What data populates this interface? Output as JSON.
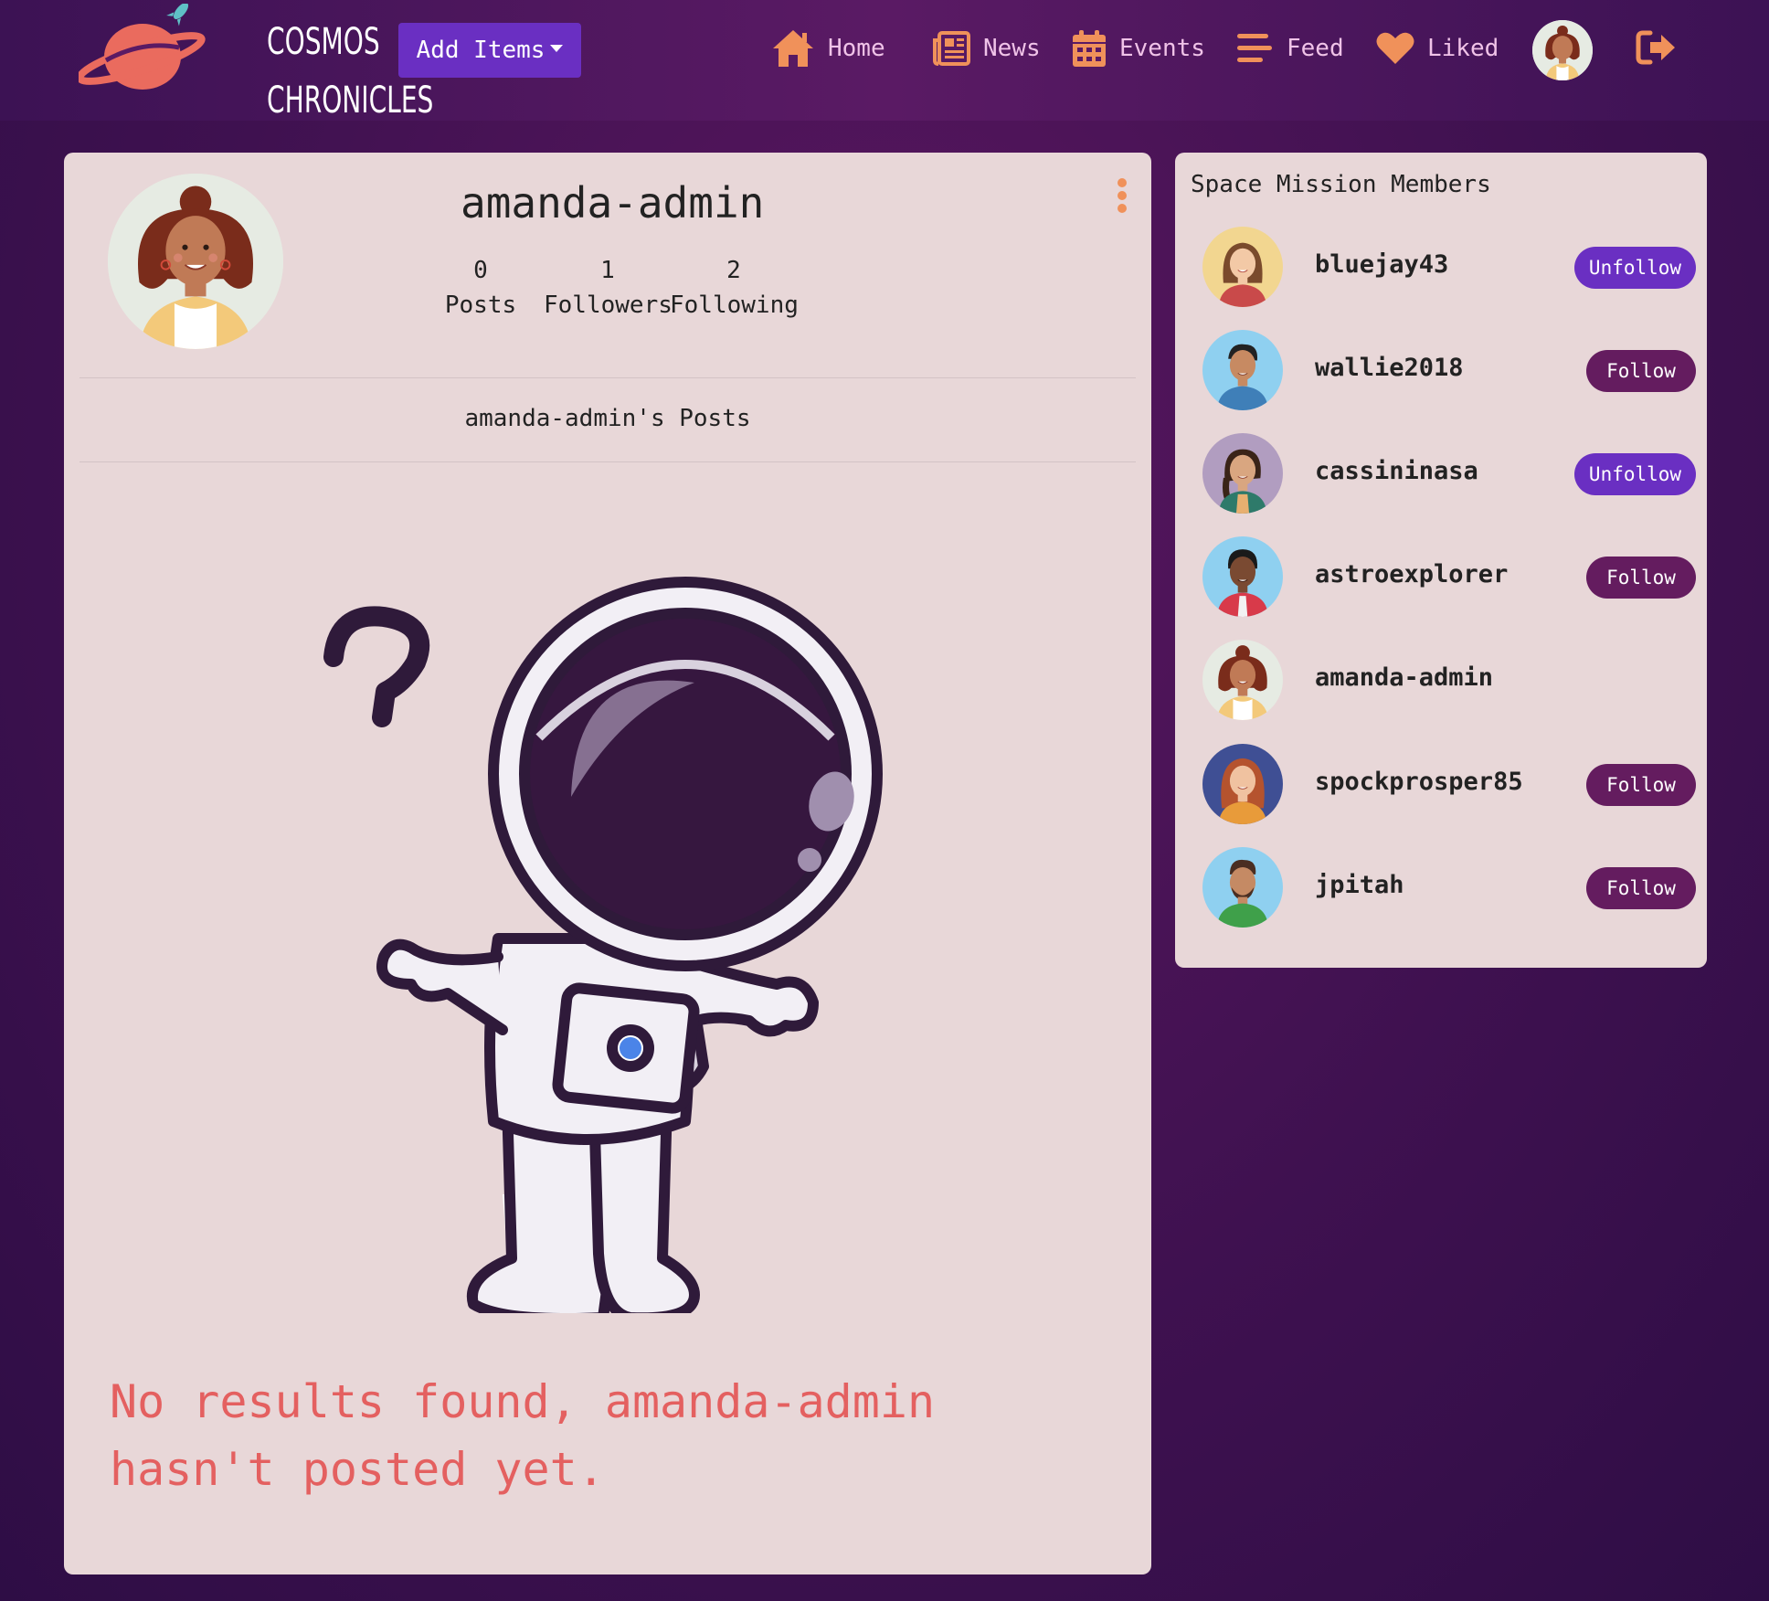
{
  "brand": {
    "line1": "COSMOS",
    "line2": "CHRONICLES"
  },
  "nav": {
    "add_items_label": "Add Items",
    "items": [
      {
        "label": "Home",
        "icon": "home-icon"
      },
      {
        "label": "News",
        "icon": "newspaper-icon"
      },
      {
        "label": "Events",
        "icon": "calendar-icon"
      },
      {
        "label": "Feed",
        "icon": "feed-lines-icon"
      },
      {
        "label": "Liked",
        "icon": "heart-icon"
      }
    ],
    "logout_icon": "logout-icon"
  },
  "colors": {
    "accent_orange": "#f0915a",
    "primary_purple": "#6a2fc2",
    "follow_plum": "#641c5f",
    "error_red": "#e46060",
    "card_bg": "#e8d7d8"
  },
  "profile": {
    "username": "amanda-admin",
    "stats": [
      {
        "count": "0",
        "label": "Posts"
      },
      {
        "count": "1",
        "label": "Followers"
      },
      {
        "count": "2",
        "label": "Following"
      }
    ],
    "posts_heading": "amanda-admin's Posts",
    "empty_message": "No results found, amanda-admin hasn't posted yet."
  },
  "members": {
    "title": "Space Mission Members",
    "list": [
      {
        "username": "bluejay43",
        "action": "Unfollow"
      },
      {
        "username": "wallie2018",
        "action": "Follow"
      },
      {
        "username": "cassininasa",
        "action": "Unfollow"
      },
      {
        "username": "astroexplorer",
        "action": "Follow"
      },
      {
        "username": "amanda-admin",
        "action": ""
      },
      {
        "username": "spockprosper85",
        "action": "Follow"
      },
      {
        "username": "jpitah",
        "action": "Follow"
      }
    ]
  }
}
